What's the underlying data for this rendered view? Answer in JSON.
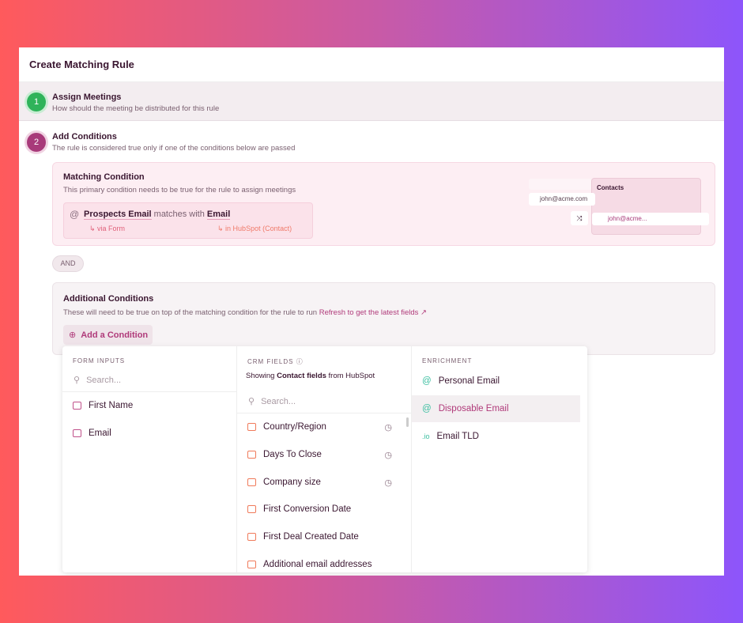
{
  "title": "Create Matching Rule",
  "steps": [
    {
      "number": "1",
      "title": "Assign Meetings",
      "subtitle": "How should the meeting be distributed for this rule",
      "color": "#2fb35a"
    },
    {
      "number": "2",
      "title": "Add Conditions",
      "subtitle": "The rule is considered true only if one of the conditions below are passed",
      "color": "#a83a7a"
    }
  ],
  "matching": {
    "title": "Matching Condition",
    "subtitle": "This primary condition needs to be true for the rule to assign meetings",
    "left_field": "Prospects Email",
    "operator": "matches with",
    "right_field": "Email",
    "left_source": "via Form",
    "right_source": "in HubSpot (Contact)",
    "illustration": {
      "email": "john@acme.com",
      "table_title": "Contacts",
      "matched": "john@acme..."
    }
  },
  "and_label": "AND",
  "additional": {
    "title": "Additional Conditions",
    "subtitle": "These will need to be true on top of the matching condition for the rule to run",
    "refresh_link": "Refresh to get the latest fields ↗",
    "add_button": "Add a Condition"
  },
  "dropdown": {
    "form_inputs": {
      "header": "FORM INPUTS",
      "search_placeholder": "Search...",
      "items": [
        "First Name",
        "Email"
      ]
    },
    "crm_fields": {
      "header": "CRM FIELDS",
      "showing_prefix": "Showing",
      "showing_bold": "Contact fields",
      "showing_suffix": "from HubSpot",
      "search_placeholder": "Search...",
      "items": [
        "Country/Region",
        "Days To Close",
        "Company size",
        "First Conversion Date",
        "First Deal Created Date",
        "Additional email addresses"
      ]
    },
    "enrichment": {
      "header": "ENRICHMENT",
      "items": [
        "Personal Email",
        "Disposable Email",
        "Email TLD"
      ],
      "selected": "Disposable Email"
    }
  },
  "colors": {
    "accent": "#b03a7a",
    "crm_icon": "#f07a5a",
    "enrich_icon": "#3bbfa0"
  }
}
